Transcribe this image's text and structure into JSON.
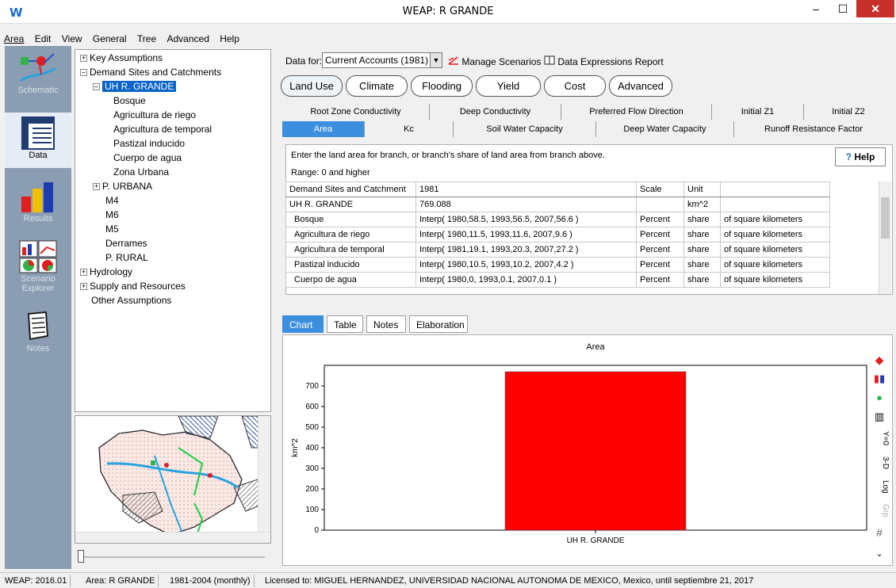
{
  "window": {
    "title": "WEAP: R GRANDE",
    "logo": "W",
    "minimize": "–",
    "maximize": "☐",
    "close": "✕"
  },
  "menu": [
    "Area",
    "Edit",
    "View",
    "General",
    "Tree",
    "Advanced",
    "Help"
  ],
  "toolbar": {
    "schematic": "Schematic",
    "data": "Data",
    "results": "Results",
    "scenario_explorer_1": "Scenario",
    "scenario_explorer_2": "Explorer",
    "notes": "Notes"
  },
  "tree": {
    "key_assumptions": "Key Assumptions",
    "demand_sites": "Demand Sites and Catchments",
    "uh_grande": "UH R. GRANDE",
    "children": [
      "Bosque",
      "Agricultura de riego",
      "Agricultura de temporal",
      "Pastizal inducido",
      "Cuerpo de agua",
      "Zona Urbana"
    ],
    "p_urbana": "P. URBANA",
    "siblings": [
      "M4",
      "M6",
      "M5",
      "Derrames",
      "P. RURAL"
    ],
    "hydrology": "Hydrology",
    "supply": "Supply and Resources",
    "other": "Other Assumptions"
  },
  "data_for": {
    "label": "Data for:",
    "value": "Current Accounts (1981)",
    "manage": "Manage Scenarios",
    "report": "Data Expressions Report"
  },
  "category_tabs": [
    "Land Use",
    "Climate",
    "Flooding",
    "Yield",
    "Cost",
    "Advanced"
  ],
  "sub_tabs_row1": [
    "Root Zone Conductivity",
    "Deep Conductivity",
    "Preferred Flow Direction",
    "Initial Z1",
    "Initial Z2"
  ],
  "sub_tabs_row2": [
    "Area",
    "Kc",
    "Soil Water Capacity",
    "Deep Water Capacity",
    "Runoff Resistance Factor"
  ],
  "instructions": "Enter the land area for branch, or branch's share of land area from branch above.",
  "range": "Range: 0 and higher",
  "help": "Help",
  "grid": {
    "headers": [
      "Demand Sites and Catchment",
      "1981",
      "Scale",
      "Unit",
      ""
    ],
    "rows": [
      [
        "UH R. GRANDE",
        "769.088",
        "",
        "km^2",
        ""
      ],
      [
        "Bosque",
        "Interp( 1980,58.5,  1993,56.5,  2007,56.6 )",
        "Percent",
        "share",
        "of square kilometers"
      ],
      [
        "Agricultura de riego",
        "Interp( 1980,11.5,  1993,11.6,  2007,9.6 )",
        "Percent",
        "share",
        "of square kilometers"
      ],
      [
        "Agricultura de temporal",
        "Interp( 1981,19.1,  1993,20.3,  2007,27.2 )",
        "Percent",
        "share",
        "of square kilometers"
      ],
      [
        "Pastizal inducido",
        "Interp( 1980,10.5,  1993,10.2,  2007,4.2 )",
        "Percent",
        "share",
        "of square kilometers"
      ],
      [
        "Cuerpo de agua",
        "Interp( 1980,0,  1993,0.1,  2007,0.1 )",
        "Percent",
        "share",
        "of square kilometers"
      ]
    ]
  },
  "bottom_tabs": [
    "Chart",
    "Table",
    "Notes",
    "Elaboration"
  ],
  "chart_tools": [
    "Y=0",
    "3-D",
    "Log",
    "Grp",
    "#"
  ],
  "chart_data": {
    "type": "bar",
    "title": "Area",
    "ylabel": "km^2",
    "categories": [
      "UH R. GRANDE"
    ],
    "values": [
      769.088
    ],
    "ylim": [
      0,
      800
    ],
    "yticks": [
      0,
      100,
      200,
      300,
      400,
      500,
      600,
      700
    ],
    "bar_color": "#ff0000"
  },
  "status": [
    "WEAP: 2016.01",
    "Area: R GRANDE",
    "1981-2004 (monthly)",
    "Licensed to: MIGUEL HERNANDEZ, UNIVERSIDAD NACIONAL AUTONOMA DE MEXICO, Mexico, until septiembre 21, 2017"
  ],
  "colors": {
    "toolbar": "#8b9db2",
    "selection": "#0a64c8",
    "active_tab": "#3c8fde",
    "close": "#c7302b"
  }
}
